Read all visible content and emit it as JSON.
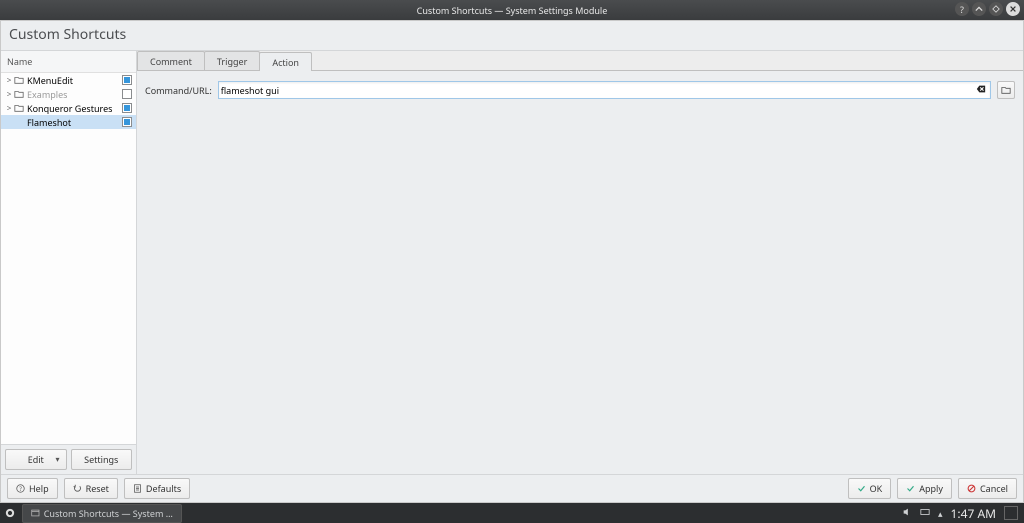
{
  "titlebar": {
    "title": "Custom Shortcuts — System Settings Module"
  },
  "module_title": "Custom Shortcuts",
  "sidebar": {
    "header": "Name",
    "items": [
      {
        "label": "KMenuEdit",
        "kind": "folder",
        "expandable": true,
        "checked": true,
        "dim": false
      },
      {
        "label": "Examples",
        "kind": "folder",
        "expandable": true,
        "checked": false,
        "dim": true
      },
      {
        "label": "Konqueror Gestures",
        "kind": "folder",
        "expandable": true,
        "checked": true,
        "dim": false
      },
      {
        "label": "Flameshot",
        "kind": "item",
        "expandable": false,
        "checked": true,
        "dim": false,
        "selected": true
      }
    ],
    "edit_label": "Edit",
    "settings_label": "Settings"
  },
  "tabs": {
    "items": [
      {
        "label": "Comment",
        "active": false
      },
      {
        "label": "Trigger",
        "active": false
      },
      {
        "label": "Action",
        "active": true
      }
    ]
  },
  "form": {
    "command_label": "Command/URL:",
    "command_value": "flameshot gui"
  },
  "footer": {
    "help": "Help",
    "reset": "Reset",
    "defaults": "Defaults",
    "ok": "OK",
    "apply": "Apply",
    "cancel": "Cancel"
  },
  "taskbar": {
    "task_label": "Custom Shortcuts — System Setti...",
    "clock": "1:47 AM"
  }
}
